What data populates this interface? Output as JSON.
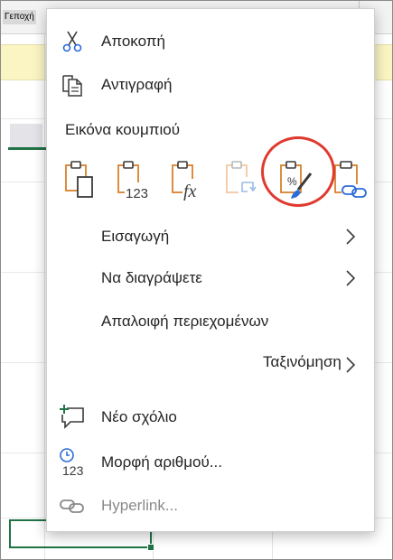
{
  "sheet": {
    "corner_tag": "Γεποχή"
  },
  "menu": {
    "cut": {
      "label": "Αποκοπή",
      "icon": "scissors-icon"
    },
    "copy": {
      "label": "Αντιγραφή",
      "icon": "copy-icon"
    },
    "paste_section": {
      "title": "Εικόνα κουμπιού",
      "options": [
        {
          "name": "paste-keep-source",
          "icon": "clipboard-page-icon",
          "sub": ""
        },
        {
          "name": "paste-values",
          "icon": "clipboard-values-icon",
          "sub": "123"
        },
        {
          "name": "paste-formulas",
          "icon": "clipboard-formula-icon",
          "sub": "fx"
        },
        {
          "name": "paste-transpose",
          "icon": "clipboard-transpose-icon",
          "sub": ""
        },
        {
          "name": "paste-formatting",
          "icon": "clipboard-brush-icon",
          "sub": ""
        },
        {
          "name": "paste-link",
          "icon": "clipboard-link-icon",
          "sub": ""
        }
      ]
    },
    "insert": {
      "label": "Εισαγωγή"
    },
    "delete": {
      "label": "Να διαγράψετε"
    },
    "clear": {
      "label": "Απαλοιφή περιεχομένων"
    },
    "sort": {
      "label": "Ταξινόμηση"
    },
    "new_comment": {
      "label": "Νέο σχόλιο",
      "icon": "comment-plus-icon"
    },
    "number_format": {
      "label": "Μορφή αριθμού...",
      "icon": "number-format-icon",
      "sub": "123"
    },
    "hyperlink": {
      "label": "Hyperlink...",
      "icon": "link-icon"
    }
  },
  "colors": {
    "accent_orange": "#d9822b",
    "excel_green": "#217346",
    "highlight_red": "#e03a2f",
    "link_blue": "#2b6cd9"
  }
}
